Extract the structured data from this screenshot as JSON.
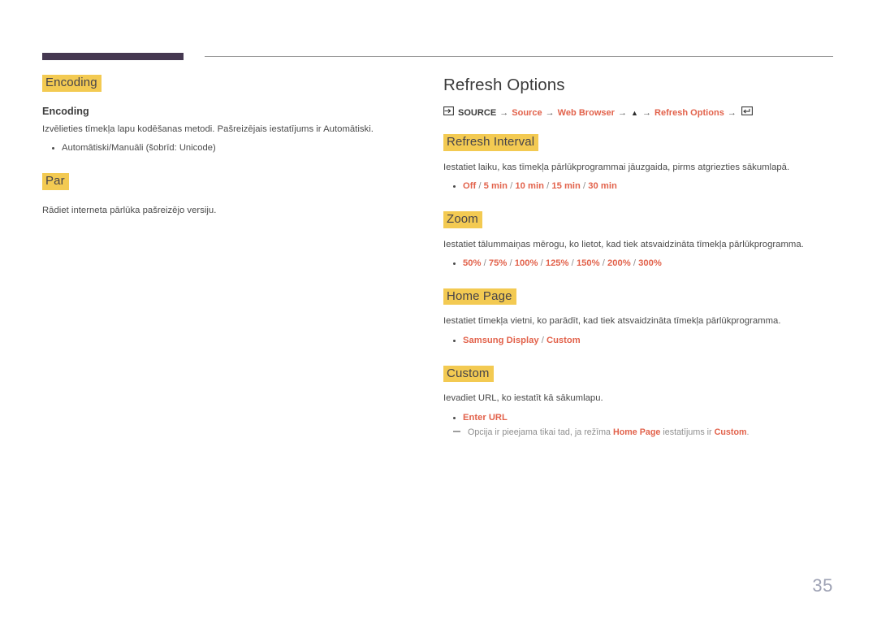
{
  "page": {
    "number": "35",
    "accent_color": "#e2624b",
    "highlight_color": "#f3ca52",
    "rule_bar_color": "#453851",
    "page_number_color": "#9ea2b4"
  },
  "left_column": {
    "sections": [
      {
        "heading": "Encoding",
        "sub_heading": "Encoding",
        "body": "Izvēlieties tīmekļa lapu kodēšanas metodi. Pašreizējais iestatījums ir Automātiski.",
        "bullets": [
          {
            "text": "Automātiski/Manuāli (šobrīd: Unicode)",
            "accent": false
          }
        ]
      },
      {
        "heading": "Par",
        "sub_heading": "",
        "body": "Rādiet interneta pārlūka pašreizējo versiju.",
        "bullets": []
      }
    ]
  },
  "right_column": {
    "title": "Refresh Options",
    "breadcrumb": {
      "source_icon": "source-input-icon",
      "enter_icon": "enter-key-icon",
      "up_arrow": "▲",
      "arrow": "→",
      "items": [
        {
          "label": "SOURCE",
          "style": "strong"
        },
        {
          "label": "Source",
          "style": "accent"
        },
        {
          "label": "Web Browser",
          "style": "accent"
        },
        {
          "label": "▲",
          "style": "up"
        },
        {
          "label": "Refresh Options",
          "style": "accent"
        }
      ]
    },
    "sections": [
      {
        "heading": "Refresh Interval",
        "body": "Iestatiet laiku, kas tīmekļa pārlūkprogrammai jāuzgaida, pirms atgriezties sākumlapā.",
        "options": [
          "Off",
          "5 min",
          "10 min",
          "15 min",
          "30 min"
        ],
        "note": null
      },
      {
        "heading": "Zoom",
        "body": "Iestatiet tālummaiņas mērogu, ko lietot, kad tiek atsvaidzināta tīmekļa pārlūkprogramma.",
        "options": [
          "50%",
          "75%",
          "100%",
          "125%",
          "150%",
          "200%",
          "300%"
        ],
        "note": null
      },
      {
        "heading": "Home Page",
        "body": "Iestatiet tīmekļa vietni, ko parādīt, kad tiek atsvaidzināta tīmekļa pārlūkprogramma.",
        "options": [
          "Samsung Display",
          "Custom"
        ],
        "note": null
      },
      {
        "heading": "Custom",
        "body": "Ievadiet URL, ko iestatīt kā sākumlapu.",
        "options": [
          "Enter URL"
        ],
        "note": {
          "prefix": "Opcija ir pieejama tikai tad, ja režīma ",
          "accent1": "Home Page",
          "middle": " iestatījums ir ",
          "accent2": "Custom",
          "suffix": "."
        }
      }
    ]
  }
}
